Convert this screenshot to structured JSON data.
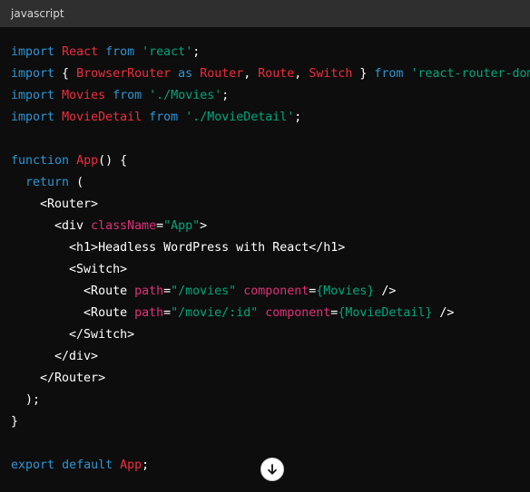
{
  "header": {
    "language": "javascript"
  },
  "colors": {
    "keyword": "#2e95d3",
    "identifier": "#f22c3d",
    "string": "#00a67d",
    "attribute": "#df3079",
    "text": "#ffffff",
    "background": "#0d0d0d",
    "header_background": "#2f2f2f"
  },
  "code": {
    "lines": [
      [
        {
          "t": "kw",
          "v": "import"
        },
        {
          "t": "plain",
          "v": " "
        },
        {
          "t": "id",
          "v": "React"
        },
        {
          "t": "plain",
          "v": " "
        },
        {
          "t": "kw",
          "v": "from"
        },
        {
          "t": "plain",
          "v": " "
        },
        {
          "t": "str",
          "v": "'react'"
        },
        {
          "t": "plain",
          "v": ";"
        }
      ],
      [
        {
          "t": "kw",
          "v": "import"
        },
        {
          "t": "plain",
          "v": " { "
        },
        {
          "t": "id",
          "v": "BrowserRouter"
        },
        {
          "t": "plain",
          "v": " "
        },
        {
          "t": "kw",
          "v": "as"
        },
        {
          "t": "plain",
          "v": " "
        },
        {
          "t": "id",
          "v": "Router"
        },
        {
          "t": "plain",
          "v": ", "
        },
        {
          "t": "id",
          "v": "Route"
        },
        {
          "t": "plain",
          "v": ", "
        },
        {
          "t": "id",
          "v": "Switch"
        },
        {
          "t": "plain",
          "v": " } "
        },
        {
          "t": "kw",
          "v": "from"
        },
        {
          "t": "plain",
          "v": " "
        },
        {
          "t": "str",
          "v": "'react-router-dom'"
        },
        {
          "t": "plain",
          "v": ";"
        }
      ],
      [
        {
          "t": "kw",
          "v": "import"
        },
        {
          "t": "plain",
          "v": " "
        },
        {
          "t": "id",
          "v": "Movies"
        },
        {
          "t": "plain",
          "v": " "
        },
        {
          "t": "kw",
          "v": "from"
        },
        {
          "t": "plain",
          "v": " "
        },
        {
          "t": "str",
          "v": "'./Movies'"
        },
        {
          "t": "plain",
          "v": ";"
        }
      ],
      [
        {
          "t": "kw",
          "v": "import"
        },
        {
          "t": "plain",
          "v": " "
        },
        {
          "t": "id",
          "v": "MovieDetail"
        },
        {
          "t": "plain",
          "v": " "
        },
        {
          "t": "kw",
          "v": "from"
        },
        {
          "t": "plain",
          "v": " "
        },
        {
          "t": "str",
          "v": "'./MovieDetail'"
        },
        {
          "t": "plain",
          "v": ";"
        }
      ],
      [],
      [
        {
          "t": "kw",
          "v": "function"
        },
        {
          "t": "plain",
          "v": " "
        },
        {
          "t": "id",
          "v": "App"
        },
        {
          "t": "plain",
          "v": "() {"
        }
      ],
      [
        {
          "t": "plain",
          "v": "  "
        },
        {
          "t": "kw",
          "v": "return"
        },
        {
          "t": "plain",
          "v": " ("
        }
      ],
      [
        {
          "t": "plain",
          "v": "    <Router>"
        }
      ],
      [
        {
          "t": "plain",
          "v": "      <div "
        },
        {
          "t": "attr",
          "v": "className"
        },
        {
          "t": "plain",
          "v": "="
        },
        {
          "t": "str",
          "v": "\"App\""
        },
        {
          "t": "plain",
          "v": ">"
        }
      ],
      [
        {
          "t": "plain",
          "v": "        <h1>Headless WordPress with React</h1>"
        }
      ],
      [
        {
          "t": "plain",
          "v": "        <Switch>"
        }
      ],
      [
        {
          "t": "plain",
          "v": "          <Route "
        },
        {
          "t": "attr",
          "v": "path"
        },
        {
          "t": "plain",
          "v": "="
        },
        {
          "t": "str",
          "v": "\"/movies\""
        },
        {
          "t": "plain",
          "v": " "
        },
        {
          "t": "attr",
          "v": "component"
        },
        {
          "t": "plain",
          "v": "="
        },
        {
          "t": "str",
          "v": "{Movies}"
        },
        {
          "t": "plain",
          "v": " />"
        }
      ],
      [
        {
          "t": "plain",
          "v": "          <Route "
        },
        {
          "t": "attr",
          "v": "path"
        },
        {
          "t": "plain",
          "v": "="
        },
        {
          "t": "str",
          "v": "\"/movie/:id\""
        },
        {
          "t": "plain",
          "v": " "
        },
        {
          "t": "attr",
          "v": "component"
        },
        {
          "t": "plain",
          "v": "="
        },
        {
          "t": "str",
          "v": "{MovieDetail}"
        },
        {
          "t": "plain",
          "v": " />"
        }
      ],
      [
        {
          "t": "plain",
          "v": "        </Switch>"
        }
      ],
      [
        {
          "t": "plain",
          "v": "      </div>"
        }
      ],
      [
        {
          "t": "plain",
          "v": "    </Router>"
        }
      ],
      [
        {
          "t": "plain",
          "v": "  );"
        }
      ],
      [
        {
          "t": "plain",
          "v": "}"
        }
      ],
      [],
      [
        {
          "t": "kw",
          "v": "export"
        },
        {
          "t": "plain",
          "v": " "
        },
        {
          "t": "kw",
          "v": "default"
        },
        {
          "t": "plain",
          "v": " "
        },
        {
          "t": "id",
          "v": "App"
        },
        {
          "t": "plain",
          "v": ";"
        }
      ]
    ]
  },
  "scroll_button": {
    "icon": "arrow-down-icon"
  }
}
